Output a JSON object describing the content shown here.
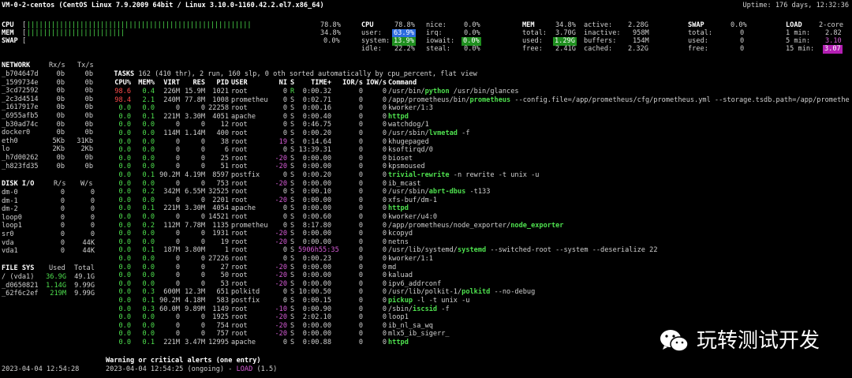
{
  "header": {
    "left": "VM-0-2-centos (CentOS Linux 7.9.2009 64bit / Linux 3.10.0-1160.42.2.el7.x86_64)",
    "right": "Uptime: 176 days, 12:32:36"
  },
  "quicklook": {
    "cpu_label": "CPU",
    "cpu_pct": "78.8%",
    "cpu_fill": 0.788,
    "mem_label": "MEM",
    "mem_pct": "34.8%",
    "mem_fill": 0.348,
    "swap_label": "SWAP",
    "swap_pct": "0.0%",
    "swap_fill": 0.0
  },
  "cpu": {
    "title": "CPU",
    "total": "78.8%",
    "rows": [
      [
        "user:",
        "63.9%",
        "irq:",
        "0.0%"
      ],
      [
        "system:",
        "13.9%",
        "iowait:",
        "0.0%"
      ],
      [
        "idle:",
        "22.2%",
        "steal:",
        "0.0%"
      ]
    ],
    "nice_label": "nice:",
    "nice_val": "0.0%"
  },
  "mem": {
    "title": "MEM",
    "total_pct": "34.8%",
    "active_label": "active:",
    "active": "2.28G",
    "rows": [
      [
        "total:",
        "3.70G",
        "inactive:",
        "958M"
      ],
      [
        "used:",
        "1.29G",
        "buffers:",
        "154M"
      ],
      [
        "free:",
        "2.41G",
        "cached:",
        "2.32G"
      ]
    ]
  },
  "swap": {
    "title": "SWAP",
    "pct": "0.0%",
    "rows": [
      [
        "total:",
        "0"
      ],
      [
        "used:",
        "0"
      ],
      [
        "free:",
        "0"
      ]
    ]
  },
  "load": {
    "title": "LOAD",
    "cores": "2-core",
    "rows": [
      [
        "1 min:",
        "2.82"
      ],
      [
        "5 min:",
        "3.10"
      ],
      [
        "15 min:",
        "3.07"
      ]
    ]
  },
  "network": {
    "headers": [
      "NETWORK",
      "Rx/s",
      "Tx/s"
    ],
    "rows": [
      [
        "_b704647d",
        "0b",
        "0b"
      ],
      [
        "_1599734e",
        "0b",
        "0b"
      ],
      [
        "_3cd72592",
        "0b",
        "0b"
      ],
      [
        "_2c3d4514",
        "0b",
        "0b"
      ],
      [
        "_1617917e",
        "0b",
        "0b"
      ],
      [
        "_6955afb5",
        "0b",
        "0b"
      ],
      [
        "_b30ad74c",
        "0b",
        "0b"
      ],
      [
        "docker0",
        "0b",
        "0b"
      ],
      [
        "eth0",
        "5Kb",
        "31Kb"
      ],
      [
        "lo",
        "2Kb",
        "2Kb"
      ],
      [
        "_h7d00262",
        "0b",
        "0b"
      ],
      [
        "_h823fd35",
        "0b",
        "0b"
      ]
    ]
  },
  "disk": {
    "headers": [
      "DISK I/O",
      "R/s",
      "W/s"
    ],
    "rows": [
      [
        "dm-0",
        "0",
        "0"
      ],
      [
        "dm-1",
        "0",
        "0"
      ],
      [
        "dm-2",
        "0",
        "0"
      ],
      [
        "loop0",
        "0",
        "0"
      ],
      [
        "loop1",
        "0",
        "0"
      ],
      [
        "sr0",
        "0",
        "0"
      ],
      [
        "vda",
        "0",
        "44K"
      ],
      [
        "vda1",
        "0",
        "44K"
      ]
    ]
  },
  "fs": {
    "headers": [
      "FILE SYS",
      "Used",
      "Total"
    ],
    "rows": [
      [
        "/ (vda1)",
        "36.9G",
        "49.1G"
      ],
      [
        "_d0650821",
        "1.14G",
        "9.99G"
      ],
      [
        "_62f6c2ef",
        "219M",
        "9.99G"
      ]
    ]
  },
  "tasks": {
    "summary": "TASKS 162 (410 thr), 2 run, 160 slp, 0 oth sorted automatically by cpu_percent, flat view",
    "headers": [
      "CPU%",
      "MEM%",
      "VIRT",
      "RES",
      "PID",
      "USER",
      "NI",
      "S",
      "TIME+",
      "IOR/s",
      "IOW/s",
      "Command"
    ],
    "rows": [
      [
        "98.6",
        "0.4",
        "226M",
        "15.9M",
        "1021",
        "root",
        "0",
        "R",
        "0:00.32",
        "0",
        "0",
        "/usr/bin/",
        "python",
        " /usr/bin/glances"
      ],
      [
        "98.4",
        "2.1",
        "240M",
        "77.8M",
        "1008",
        "prometheu",
        "0",
        "S",
        "0:02.71",
        "0",
        "0",
        "/app/prometheus/bin/",
        "prometheus",
        " --config.file=/app/prometheus/cfg/prometheus.yml --storage.tsdb.path=/app/promethe"
      ],
      [
        "0.0",
        "0.0",
        "0",
        "0",
        "22258",
        "root",
        "0",
        "S",
        "0:00.16",
        "0",
        "0",
        "kworker/1:3",
        "",
        ""
      ],
      [
        "0.0",
        "0.1",
        "221M",
        "3.30M",
        "4051",
        "apache",
        "0",
        "S",
        "0:00.40",
        "0",
        "0",
        "",
        "httpd",
        ""
      ],
      [
        "0.0",
        "0.0",
        "0",
        "0",
        "12",
        "root",
        "0",
        "S",
        "0:46.75",
        "0",
        "0",
        "watchdog/1",
        "",
        ""
      ],
      [
        "0.0",
        "0.0",
        "114M",
        "1.14M",
        "400",
        "root",
        "0",
        "S",
        "0:00.20",
        "0",
        "0",
        "/usr/sbin/",
        "lvmetad",
        " -f"
      ],
      [
        "0.0",
        "0.0",
        "0",
        "0",
        "38",
        "root",
        "19",
        "S",
        "0:14.64",
        "0",
        "0",
        "khugepaged",
        "",
        ""
      ],
      [
        "0.0",
        "0.0",
        "0",
        "0",
        "6",
        "root",
        "0",
        "S",
        "13:39.31",
        "0",
        "0",
        "ksoftirqd/0",
        "",
        ""
      ],
      [
        "0.0",
        "0.0",
        "0",
        "0",
        "25",
        "root",
        "-20",
        "S",
        "0:00.00",
        "0",
        "0",
        "bioset",
        "",
        ""
      ],
      [
        "0.0",
        "0.0",
        "0",
        "0",
        "51",
        "root",
        "-20",
        "S",
        "0:00.00",
        "0",
        "0",
        "kpsmoused",
        "",
        ""
      ],
      [
        "0.0",
        "0.1",
        "90.2M",
        "4.19M",
        "8597",
        "postfix",
        "0",
        "S",
        "0:00.20",
        "0",
        "0",
        "",
        "trivial-rewrite",
        " -n rewrite -t unix -u"
      ],
      [
        "0.0",
        "0.0",
        "0",
        "0",
        "753",
        "root",
        "-20",
        "S",
        "0:00.00",
        "0",
        "0",
        "ib_mcast",
        "",
        ""
      ],
      [
        "0.0",
        "0.2",
        "342M",
        "6.55M",
        "32525",
        "root",
        "0",
        "S",
        "0:00.10",
        "0",
        "0",
        "/usr/sbin/",
        "abrt-dbus",
        " -t133"
      ],
      [
        "0.0",
        "0.0",
        "0",
        "0",
        "2201",
        "root",
        "-20",
        "S",
        "0:00.00",
        "0",
        "0",
        "xfs-buf/dm-1",
        "",
        ""
      ],
      [
        "0.0",
        "0.1",
        "221M",
        "3.30M",
        "4054",
        "apache",
        "0",
        "S",
        "0:00.00",
        "0",
        "0",
        "",
        "httpd",
        ""
      ],
      [
        "0.0",
        "0.0",
        "0",
        "0",
        "14521",
        "root",
        "0",
        "S",
        "0:00.60",
        "0",
        "0",
        "kworker/u4:0",
        "",
        ""
      ],
      [
        "0.0",
        "0.2",
        "112M",
        "7.78M",
        "1135",
        "prometheu",
        "0",
        "S",
        "8:17.80",
        "0",
        "0",
        "/app/prometheus/node_exporter/",
        "node_exporter",
        ""
      ],
      [
        "0.0",
        "0.0",
        "0",
        "0",
        "1931",
        "root",
        "-20",
        "S",
        "0:00.00",
        "0",
        "0",
        "kcopyd",
        "",
        ""
      ],
      [
        "0.0",
        "0.0",
        "0",
        "0",
        "19",
        "root",
        "-20",
        "S",
        "0:00.00",
        "0",
        "0",
        "netns",
        "",
        ""
      ],
      [
        "0.0",
        "0.1",
        "187M",
        "3.80M",
        "1",
        "root",
        "0",
        "S",
        "5906h55:35",
        "0",
        "0",
        "/usr/lib/systemd/",
        "systemd",
        " --switched-root --system --deserialize 22"
      ],
      [
        "0.0",
        "0.0",
        "0",
        "0",
        "27226",
        "root",
        "0",
        "S",
        "0:00.23",
        "0",
        "0",
        "kworker/1:1",
        "",
        ""
      ],
      [
        "0.0",
        "0.0",
        "0",
        "0",
        "27",
        "root",
        "-20",
        "S",
        "0:00.00",
        "0",
        "0",
        "md",
        "",
        ""
      ],
      [
        "0.0",
        "0.0",
        "0",
        "0",
        "50",
        "root",
        "-20",
        "S",
        "0:00.00",
        "0",
        "0",
        "kaluad",
        "",
        ""
      ],
      [
        "0.0",
        "0.0",
        "0",
        "0",
        "53",
        "root",
        "-20",
        "S",
        "0:00.00",
        "0",
        "0",
        "ipv6_addrconf",
        "",
        ""
      ],
      [
        "0.0",
        "0.3",
        "600M",
        "12.3M",
        "651",
        "polkitd",
        "0",
        "S",
        "10:00.50",
        "0",
        "0",
        "/usr/lib/polkit-1/",
        "polkitd",
        " --no-debug"
      ],
      [
        "0.0",
        "0.1",
        "90.2M",
        "4.18M",
        "583",
        "postfix",
        "0",
        "S",
        "0:00.15",
        "0",
        "0",
        "",
        "pickup",
        " -l -t unix -u"
      ],
      [
        "0.0",
        "0.3",
        "60.0M",
        "9.89M",
        "1149",
        "root",
        "-10",
        "S",
        "0:00.90",
        "0",
        "0",
        "/sbin/",
        "iscsid",
        " -f"
      ],
      [
        "0.0",
        "0.0",
        "0",
        "0",
        "1925",
        "root",
        "-20",
        "S",
        "2:02.10",
        "0",
        "0",
        "loop1",
        "",
        ""
      ],
      [
        "0.0",
        "0.0",
        "0",
        "0",
        "754",
        "root",
        "-20",
        "S",
        "0:00.00",
        "0",
        "0",
        "ib_nl_sa_wq",
        "",
        ""
      ],
      [
        "0.0",
        "0.0",
        "0",
        "0",
        "757",
        "root",
        "-20",
        "S",
        "0:00.00",
        "0",
        "0",
        "mlx5_ib_sigerr_",
        "",
        ""
      ],
      [
        "0.0",
        "0.1",
        "221M",
        "3.47M",
        "12995",
        "apache",
        "0",
        "S",
        "0:00.88",
        "0",
        "0",
        "",
        "httpd",
        ""
      ]
    ]
  },
  "alerts": {
    "title": "Warning or critical alerts (one entry)",
    "entry_prefix": "2023-04-04 12:54:25 (ongoing) - ",
    "entry_tag": "LOAD",
    "entry_suffix": " (1.5)"
  },
  "footer_time": "2023-04-04 12:54:28",
  "watermark": {
    "text": "玩转测试开发"
  },
  "colors": {
    "bg": "#000000",
    "green": "#4ee04e",
    "red": "#ff4b4b",
    "magenta": "#d65cd6",
    "blue_hl": "#2d6cdf"
  }
}
